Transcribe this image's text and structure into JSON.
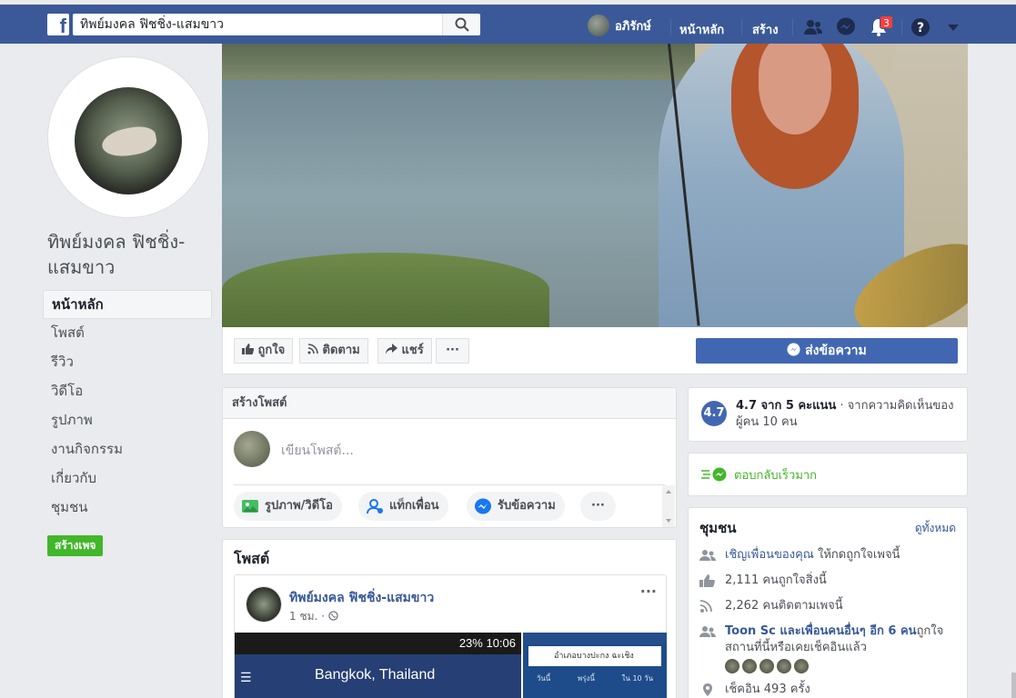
{
  "topbar": {
    "logo": "f",
    "search_value": "ทิพย์มงคล ฟิชชิ่ง-แสมขาว",
    "user_name": "อภิรักษ์",
    "home_label": "หน้าหลัก",
    "create_label": "สร้าง",
    "notification_count": "3",
    "icons": [
      "search-icon",
      "friends-icon",
      "messenger-icon",
      "bell-icon",
      "help-icon",
      "caret-down-icon"
    ],
    "brand_color": "#3b5998"
  },
  "page": {
    "name": "ทิพย์มงคล ฟิชชิ่ง-แสมขาว"
  },
  "sidebar": {
    "items": [
      {
        "label": "หน้าหลัก",
        "active": true
      },
      {
        "label": "โพสต์"
      },
      {
        "label": "รีวิว"
      },
      {
        "label": "วิดีโอ"
      },
      {
        "label": "รูปภาพ"
      },
      {
        "label": "งานกิจกรรม"
      },
      {
        "label": "เกี่ยวกับ"
      },
      {
        "label": "ชุมชน"
      }
    ],
    "create_page_label": "สร้างเพจ"
  },
  "actions": {
    "like_label": "ถูกใจ",
    "follow_label": "ติดตาม",
    "share_label": "แชร์",
    "more_label": "···",
    "send_message_label": "ส่งข้อความ"
  },
  "composer": {
    "title": "สร้างโพสต์",
    "placeholder": "เขียนโพสต์...",
    "photo_label": "รูปภาพ/วิดีโอ",
    "tag_label": "แท็กเพื่อน",
    "messages_label": "รับข้อความ",
    "more_label": "···"
  },
  "posts": {
    "title": "โพสต์",
    "items": [
      {
        "author": "ทิพย์มงคล ฟิชชิ่ง-แสมขาว",
        "time": "1 ชม. ·",
        "more": "···",
        "phone_status": "23% 10:06",
        "phone_city": "Bangkok, Thailand",
        "phone2_search": "อำเภอบางปะกง ฉะเชิง",
        "phone2_tabs": [
          "วันนี้",
          "พรุ่งนี้",
          "ใน 10 วัน"
        ]
      }
    ]
  },
  "rating": {
    "score": "4.7",
    "main": "4.7 จาก 5 คะแนน",
    "detail": " · จากความคิดเห็นของผู้คน 10 คน"
  },
  "responsiveness": {
    "label": "ตอบกลับเร็วมาก"
  },
  "community": {
    "title": "ชุมชน",
    "see_all": "ดูทั้งหมด",
    "invite_link": "เชิญเพื่อนของคุณ",
    "invite_rest": " ให้กดถูกใจเพจนี้",
    "likes": "2,111 คนถูกใจสิ่งนี้",
    "follows": "2,262 คนติดตามเพจนี้",
    "friends_link": "Toon Sc และเพื่อนคนอื่นๆ อีก 6 คน",
    "friends_rest": "ถูกใจสถานที่นี้หรือเคยเช็คอินแล้ว",
    "checkins": "เช็คอิน 493 ครั้ง"
  }
}
